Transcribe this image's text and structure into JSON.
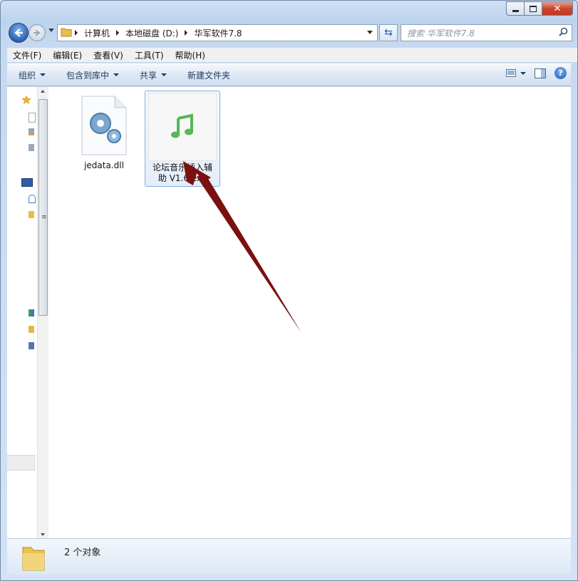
{
  "window": {
    "controls": {
      "minimize": "minimize-icon",
      "maximize": "maximize-icon",
      "close": "close-icon"
    }
  },
  "address": {
    "segments": [
      "计算机",
      "本地磁盘 (D:)",
      "华军软件7.8"
    ]
  },
  "search": {
    "placeholder": "搜索 华军软件7.8"
  },
  "menu": [
    "文件(F)",
    "编辑(E)",
    "查看(V)",
    "工具(T)",
    "帮助(H)"
  ],
  "toolbar": {
    "organize": "组织",
    "include_library": "包含到库中",
    "share": "共享",
    "new_folder": "新建文件夹"
  },
  "files": [
    {
      "name": "jedata.dll",
      "icon": "dll-gear-icon",
      "selected": false
    },
    {
      "name": "论坛音乐插入辅助 V1.6.exe",
      "name_line1": "论坛音乐插入辅",
      "name_line2": "助 V1.6.exe",
      "icon": "music-note-icon",
      "selected": true
    }
  ],
  "status": {
    "count_text": "2 个对象"
  },
  "colors": {
    "accent": "#1f58b3",
    "arrow": "#7a1010",
    "music": "#4cb04c"
  }
}
